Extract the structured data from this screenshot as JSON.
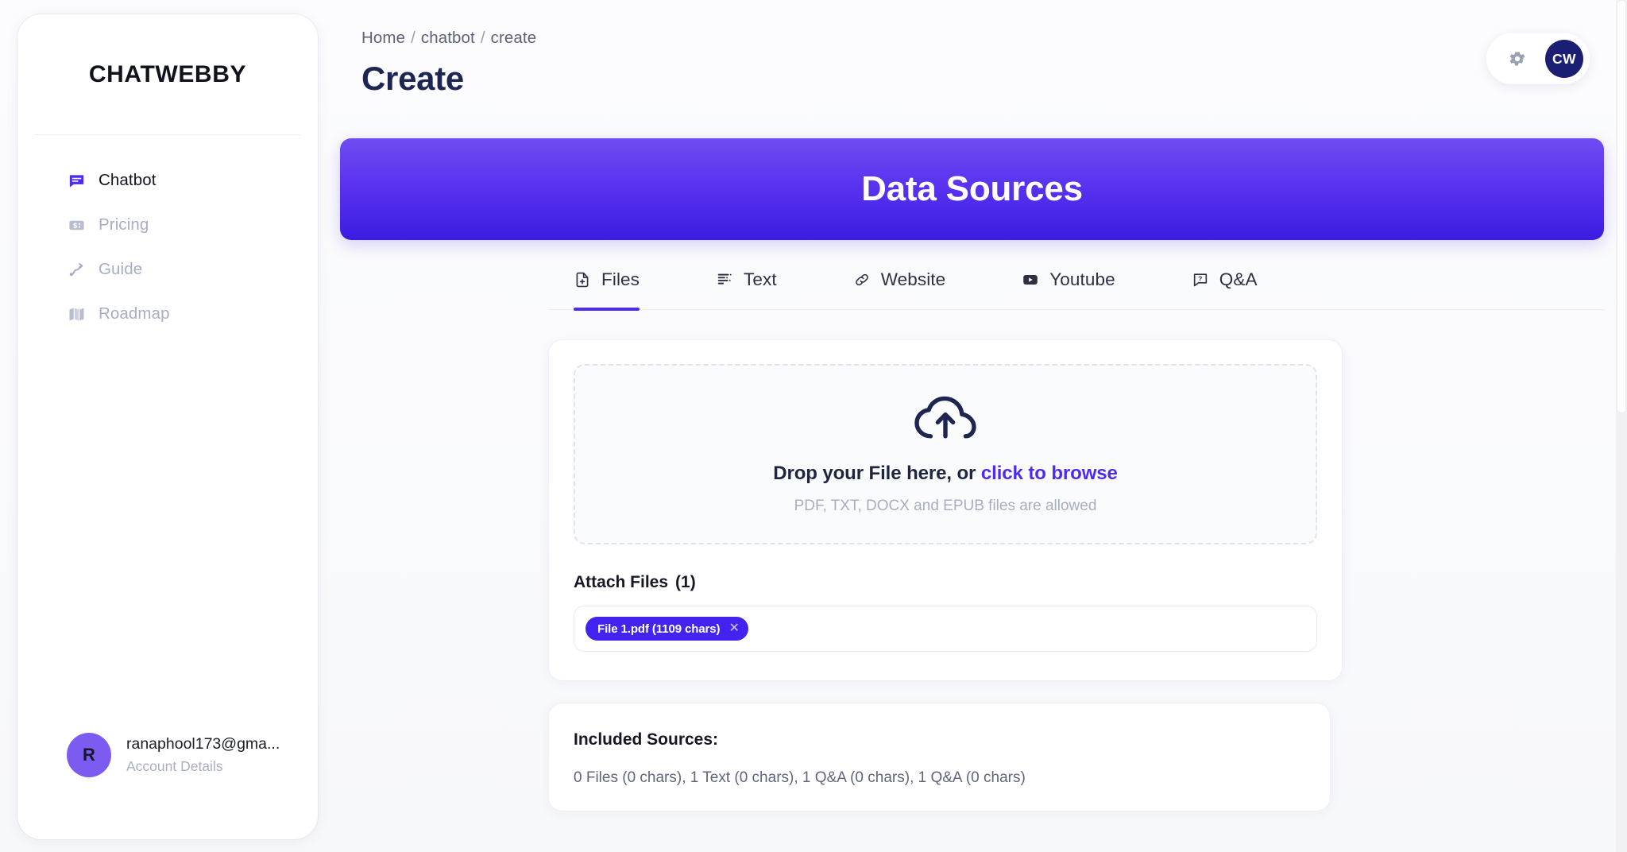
{
  "brand": {
    "name": "CHATWEBBY"
  },
  "sidebar": {
    "items": [
      {
        "label": "Chatbot",
        "icon": "chat-bubble-icon",
        "active": true
      },
      {
        "label": "Pricing",
        "icon": "price-card-icon",
        "active": false
      },
      {
        "label": "Guide",
        "icon": "route-arrow-icon",
        "active": false
      },
      {
        "label": "Roadmap",
        "icon": "map-icon",
        "active": false
      }
    ],
    "account": {
      "avatar_initial": "R",
      "email": "ranaphool173@gma...",
      "subtitle": "Account Details",
      "avatar_color": "#7c5cf0"
    }
  },
  "header": {
    "breadcrumb": [
      "Home",
      "chatbot",
      "create"
    ],
    "separator": "/",
    "title": "Create",
    "gear_icon": "gear-icon",
    "avatar_initials": "CW",
    "avatar_color": "#1a1f73"
  },
  "banner": {
    "title": "Data Sources",
    "gradient_from": "#6f4cf2",
    "gradient_to": "#3c1ce2"
  },
  "tabs": {
    "active_index": 0,
    "accent": "#4f2bf0",
    "items": [
      {
        "label": "Files",
        "icon": "file-plus-icon"
      },
      {
        "label": "Text",
        "icon": "text-lines-icon"
      },
      {
        "label": "Website",
        "icon": "link-icon"
      },
      {
        "label": "Youtube",
        "icon": "youtube-play-icon"
      },
      {
        "label": "Q&A",
        "icon": "question-bubble-icon"
      }
    ]
  },
  "dropzone": {
    "icon": "cloud-upload-icon",
    "prompt_prefix": "Drop your File here, or ",
    "prompt_link": "click to browse",
    "hint": "PDF, TXT, DOCX and EPUB files are allowed"
  },
  "attach": {
    "label": "Attach Files",
    "count": "(1)",
    "files": [
      {
        "name": "File 1.pdf (1109 chars)",
        "remove_icon": "close-icon"
      }
    ]
  },
  "included_sources": {
    "title": "Included Sources:",
    "summary": "0 Files (0 chars), 1 Text (0 chars), 1 Q&A (0 chars), 1 Q&A (0 chars)"
  }
}
